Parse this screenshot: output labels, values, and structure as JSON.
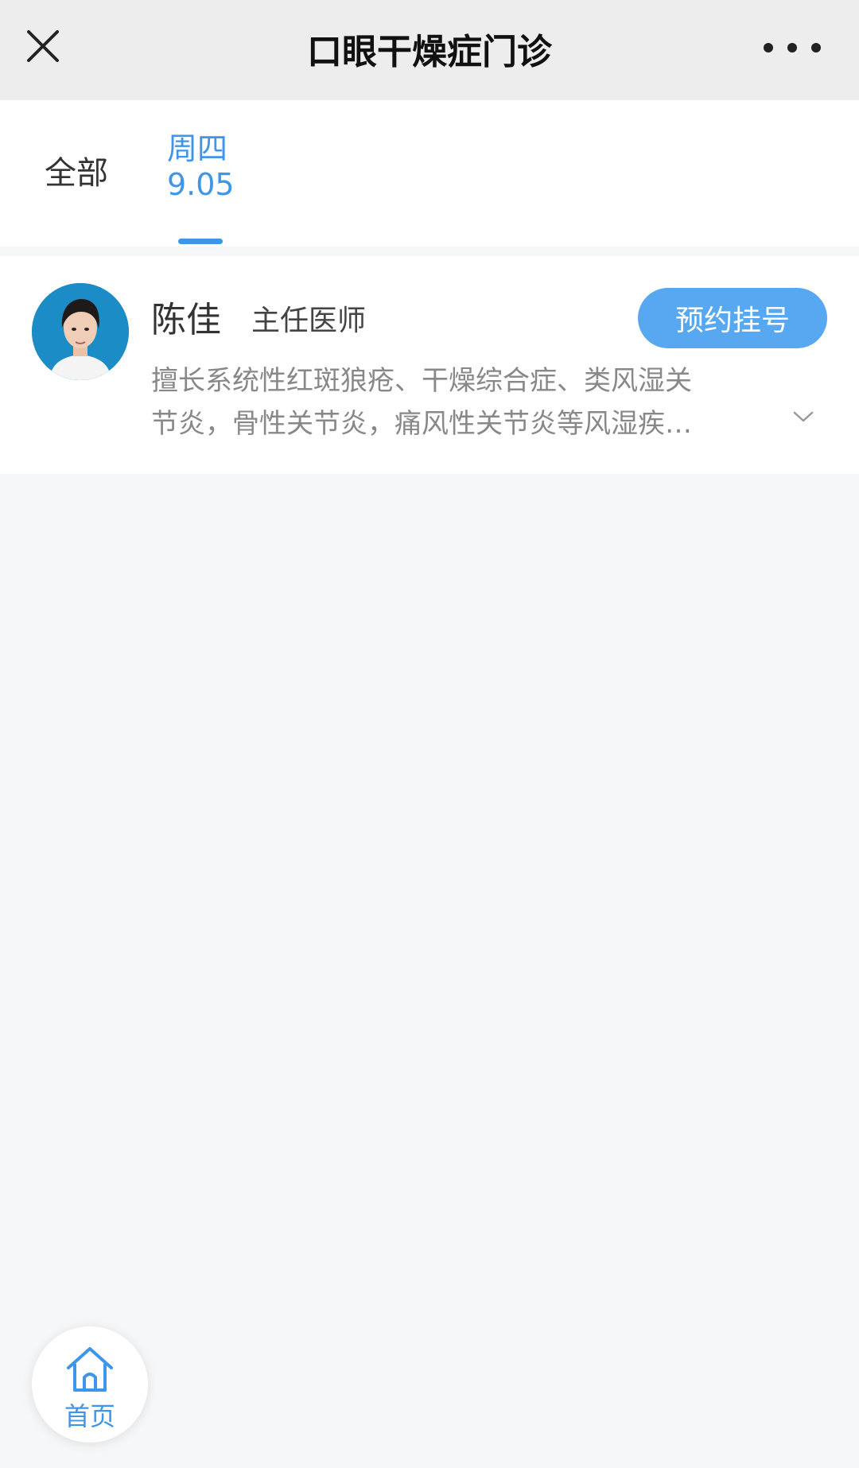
{
  "navbar": {
    "title": "口眼干燥症门诊",
    "close_icon": "close-icon",
    "more_icon": "more-icon"
  },
  "tabs": {
    "all_label": "全部",
    "active_day": "周四",
    "active_date": "9.05"
  },
  "doctor": {
    "name": "陈佳",
    "title": "主任医师",
    "book_label": "预约挂号",
    "desc_line1": "擅长系统性红斑狼疮、干燥综合症、类风湿关",
    "desc_line2": "节炎，骨性关节炎，痛风性关节炎等风湿疾…",
    "expand_icon": "chevron-down-icon"
  },
  "home": {
    "label": "首页",
    "icon": "home-icon"
  },
  "colors": {
    "accent": "#3e95e9",
    "button": "#58a8f1",
    "navbar_bg": "#ededed",
    "page_bg": "#f6f7f8"
  }
}
